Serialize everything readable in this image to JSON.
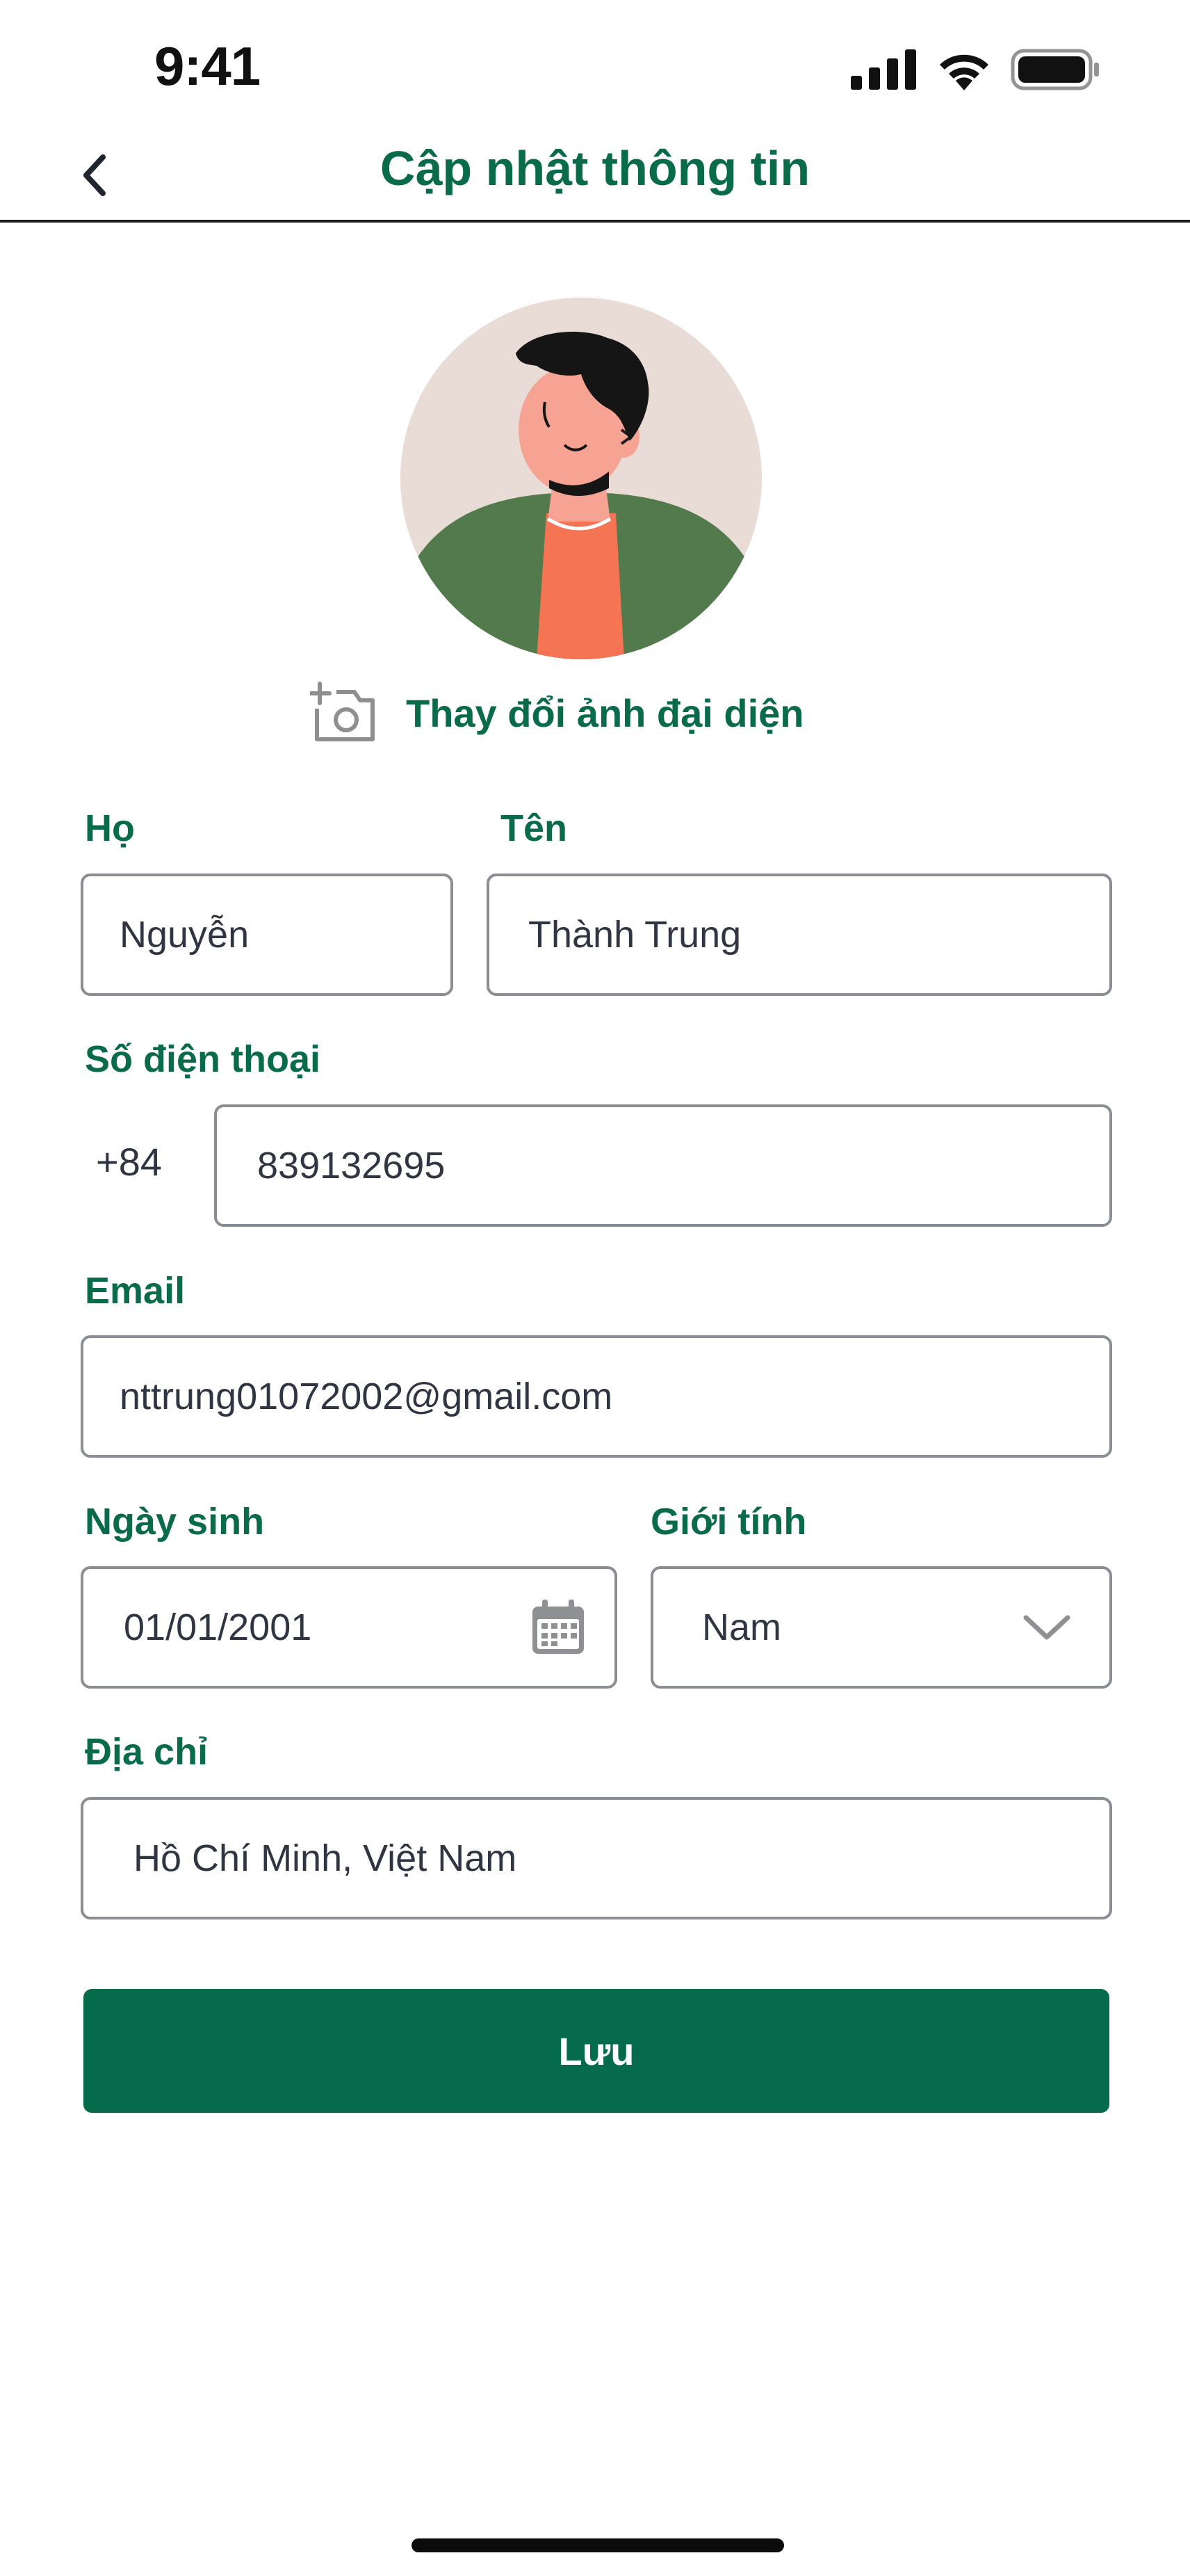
{
  "status_bar": {
    "time": "9:41"
  },
  "header": {
    "title": "Cập nhật thông tin"
  },
  "avatar": {
    "change_label": "Thay đổi ảnh đại diện"
  },
  "form": {
    "last_name": {
      "label": "Họ",
      "value": "Nguyễn"
    },
    "first_name": {
      "label": "Tên",
      "value": "Thành Trung"
    },
    "phone": {
      "label": "Số điện thoại",
      "prefix": "+84",
      "value": "839132695"
    },
    "email": {
      "label": "Email",
      "value": "nttrung01072002@gmail.com"
    },
    "birthday": {
      "label": "Ngày sinh",
      "value": "01/01/2001"
    },
    "gender": {
      "label": "Giới tính",
      "value": "Nam"
    },
    "address": {
      "label": "Địa chỉ",
      "value": "Hồ Chí Minh, Việt Nam"
    }
  },
  "actions": {
    "save_label": "Lưu"
  },
  "icons": [
    "back-chevron-icon",
    "signal-icon",
    "wifi-icon",
    "battery-icon",
    "add-photo-icon",
    "calendar-icon",
    "chevron-down-icon"
  ],
  "colors": {
    "brand_green": "#066b4b",
    "label_green": "#0a6b4b",
    "field_border": "#8a8d91",
    "text": "#2f3542"
  }
}
